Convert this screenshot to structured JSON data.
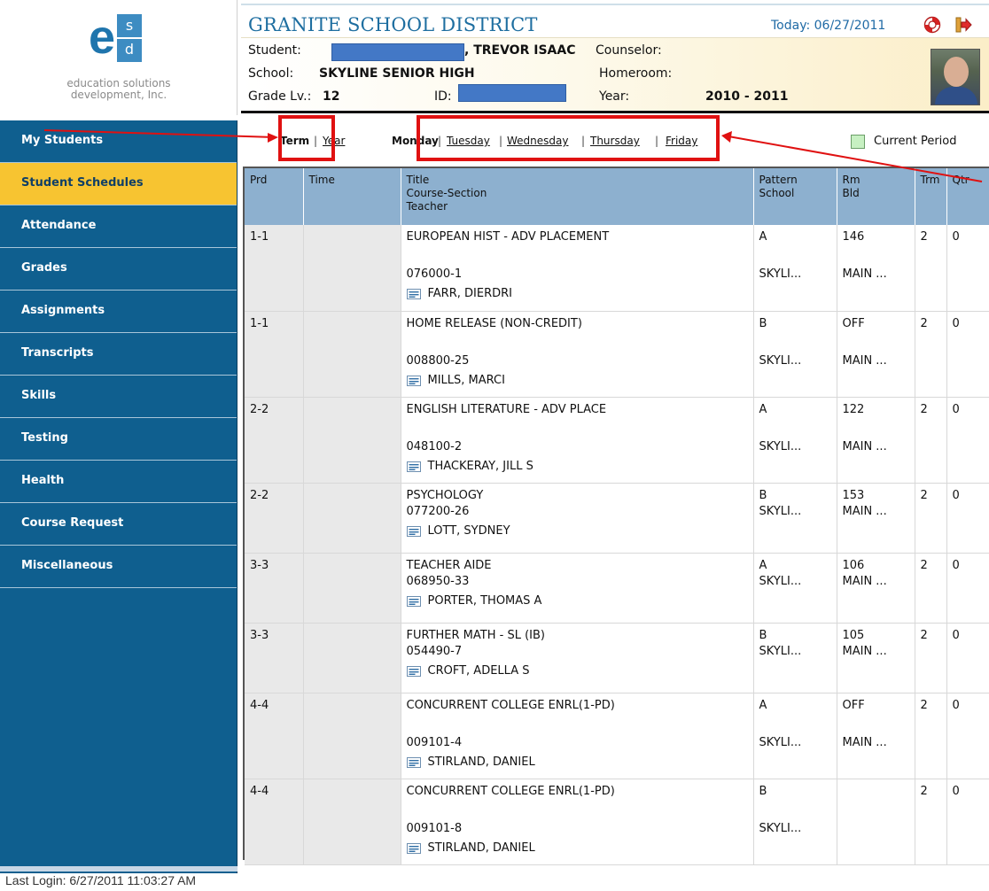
{
  "logo": {
    "letter_e": "e",
    "letter_s": "s",
    "letter_d": "d",
    "tagline_line1": "education solutions",
    "tagline_line2": "development, Inc."
  },
  "header": {
    "district": "GRANITE SCHOOL DISTRICT",
    "today": "Today: 06/27/2011",
    "help_icon": "lifebuoy-icon",
    "logout_icon": "logout-arrow-icon",
    "student_label": "Student:",
    "student_name_visible": ", TREVOR ISAAC",
    "counselor_label": "Counselor:",
    "school_label": "School:",
    "school_value": "SKYLINE SENIOR HIGH",
    "homeroom_label": "Homeroom:",
    "grade_label": "Grade Lv.:",
    "grade_value": "12",
    "id_label": "ID:",
    "year_label": "Year:",
    "year_value": "2010 - 2011",
    "redaction_color": "#4378c6"
  },
  "sidebar": {
    "items": [
      {
        "label": "My Students",
        "active": false
      },
      {
        "label": "Student Schedules",
        "active": true
      },
      {
        "label": "Attendance",
        "active": false
      },
      {
        "label": "Grades",
        "active": false
      },
      {
        "label": "Assignments",
        "active": false
      },
      {
        "label": "Transcripts",
        "active": false
      },
      {
        "label": "Skills",
        "active": false
      },
      {
        "label": "Testing",
        "active": false
      },
      {
        "label": "Health",
        "active": false
      },
      {
        "label": "Course Request",
        "active": false
      },
      {
        "label": "Miscellaneous",
        "active": false
      }
    ],
    "active_color": "#f7c431",
    "background_color": "#0f5f8f"
  },
  "view_tabs": {
    "term": "Term",
    "year": "Year",
    "days": [
      "Monday",
      "Tuesday",
      "Wednesday",
      "Thursday",
      "Friday"
    ],
    "separator": "|",
    "current_period_legend": "Current Period",
    "current_period_color": "#c7f0c2"
  },
  "schedule": {
    "headers": {
      "prd": "Prd",
      "time": "Time",
      "title": "Title",
      "course_section": "Course-Section",
      "teacher": "Teacher",
      "pattern": "Pattern",
      "school": "School",
      "rm": "Rm",
      "bld": "Bld",
      "trm": "Trm",
      "qtr": "Qtr"
    },
    "rows": [
      {
        "prd": "1-1",
        "time": "",
        "title": "EUROPEAN HIST - ADV PLACEMENT",
        "section": "076000-1",
        "teacher": "FARR, DIERDRI",
        "pattern": "A",
        "school": "SKYLI...",
        "rm": "146",
        "bld": "MAIN ...",
        "trm": "2",
        "qtr": "0"
      },
      {
        "prd": "1-1",
        "time": "",
        "title": "HOME RELEASE (NON-CREDIT)",
        "section": "008800-25",
        "teacher": "MILLS, MARCI",
        "pattern": "B",
        "school": "SKYLI...",
        "rm": "OFF",
        "bld": "MAIN ...",
        "trm": "2",
        "qtr": "0"
      },
      {
        "prd": "2-2",
        "time": "",
        "title": "ENGLISH LITERATURE - ADV PLACE",
        "section": "048100-2",
        "teacher": "THACKERAY, JILL S",
        "pattern": "A",
        "school": "SKYLI...",
        "rm": "122",
        "bld": "MAIN ...",
        "trm": "2",
        "qtr": "0"
      },
      {
        "prd": "2-2",
        "time": "",
        "title": "PSYCHOLOGY",
        "section": "077200-26",
        "teacher": "LOTT, SYDNEY",
        "pattern": "B",
        "school": "SKYLI...",
        "rm": "153",
        "bld": "MAIN ...",
        "trm": "2",
        "qtr": "0"
      },
      {
        "prd": "3-3",
        "time": "",
        "title": "TEACHER AIDE",
        "section": "068950-33",
        "teacher": "PORTER, THOMAS A",
        "pattern": "A",
        "school": "SKYLI...",
        "rm": "106",
        "bld": "MAIN ...",
        "trm": "2",
        "qtr": "0"
      },
      {
        "prd": "3-3",
        "time": "",
        "title": "FURTHER MATH - SL (IB)",
        "section": "054490-7",
        "teacher": "CROFT, ADELLA S",
        "pattern": "B",
        "school": "SKYLI...",
        "rm": "105",
        "bld": "MAIN ...",
        "trm": "2",
        "qtr": "0"
      },
      {
        "prd": "4-4",
        "time": "",
        "title": "CONCURRENT COLLEGE ENRL(1-PD)",
        "section": "009101-4",
        "teacher": "STIRLAND, DANIEL",
        "pattern": "A",
        "school": "SKYLI...",
        "rm": "OFF",
        "bld": "MAIN ...",
        "trm": "2",
        "qtr": "0"
      },
      {
        "prd": "4-4",
        "time": "",
        "title": "CONCURRENT COLLEGE ENRL(1-PD)",
        "section": "009101-8",
        "teacher": "STIRLAND, DANIEL",
        "pattern": "B",
        "school": "SKYLI...",
        "rm": "",
        "bld": "",
        "trm": "2",
        "qtr": "0"
      }
    ]
  },
  "footer": {
    "last_login": "Last Login: 6/27/2011 11:03:27 AM"
  },
  "annotation_color": "#e01111"
}
